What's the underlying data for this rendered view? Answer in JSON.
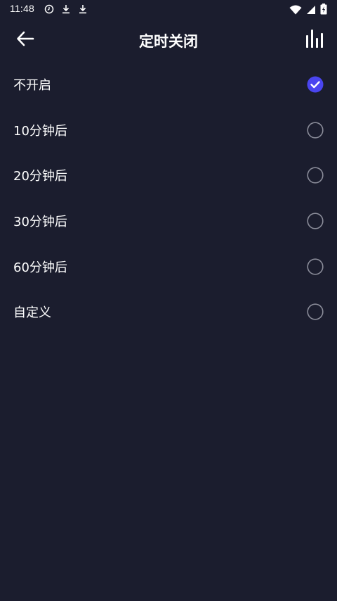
{
  "status_bar": {
    "time": "11:48",
    "left_icons": [
      "clock-icon",
      "download-icon",
      "download-icon"
    ],
    "right_icons": [
      "wifi-icon",
      "signal-icon",
      "battery-icon"
    ]
  },
  "header": {
    "title": "定时关闭",
    "back_icon": "arrow-left-icon",
    "equalizer_icon": "equalizer-icon"
  },
  "options": [
    {
      "label": "不开启",
      "selected": true
    },
    {
      "label": "10分钟后",
      "selected": false
    },
    {
      "label": "20分钟后",
      "selected": false
    },
    {
      "label": "30分钟后",
      "selected": false
    },
    {
      "label": "60分钟后",
      "selected": false
    },
    {
      "label": "自定义",
      "selected": false
    }
  ],
  "colors": {
    "background": "#1b1d2e",
    "accent": "#4a45f0",
    "radio_border": "#8a8c99",
    "text": "#ffffff"
  }
}
